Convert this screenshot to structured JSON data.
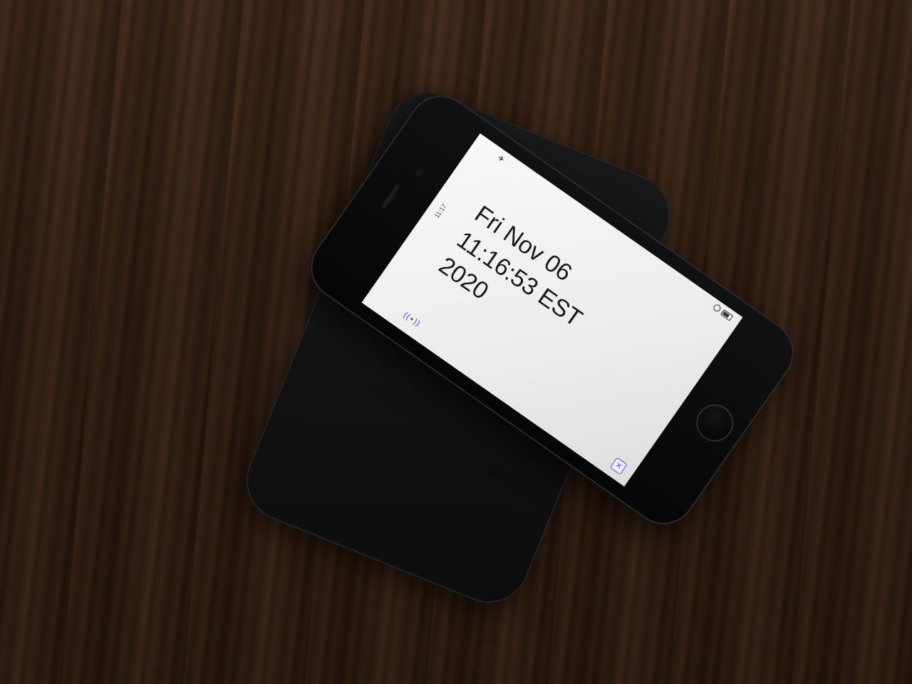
{
  "phone_screen": {
    "status_time": "11:17",
    "date_line": "Fri Nov 06",
    "time_line": "11:16:53 EST",
    "year_line": "2020",
    "icons": {
      "airplane": "airplane-icon",
      "signal": "wireless-signal-icon",
      "close": "close-box-icon"
    },
    "accent_color": "#5b4ce0"
  }
}
